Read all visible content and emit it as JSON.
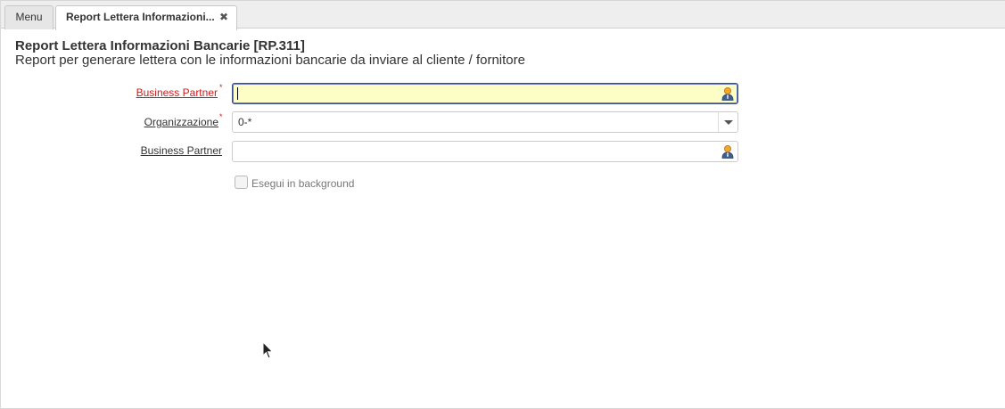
{
  "tabs": [
    {
      "label": "Menu"
    },
    {
      "label": "Report Lettera Informazioni...",
      "close": "✖"
    }
  ],
  "page": {
    "title": "Report Lettera Informazioni Bancarie [RP.311]",
    "subtitle": "Report per generare lettera con le informazioni bancarie da inviare al cliente / fornitore"
  },
  "form": {
    "field1": {
      "label": "Business Partner",
      "required_mark": "*",
      "value": "",
      "icon": "person-icon"
    },
    "field2": {
      "label": "Organizzazione",
      "required_mark": "*",
      "value": "0-*",
      "icon": "chevron-down-icon"
    },
    "field3": {
      "label": "Business Partner",
      "value": "",
      "icon": "person-icon"
    },
    "background_checkbox": {
      "label": "Esegui in background",
      "checked": false
    }
  },
  "colors": {
    "mandatory_label": "#c81e1e",
    "focused_field_bg": "#fdfdc6",
    "focused_field_border": "#3a4d8f"
  }
}
